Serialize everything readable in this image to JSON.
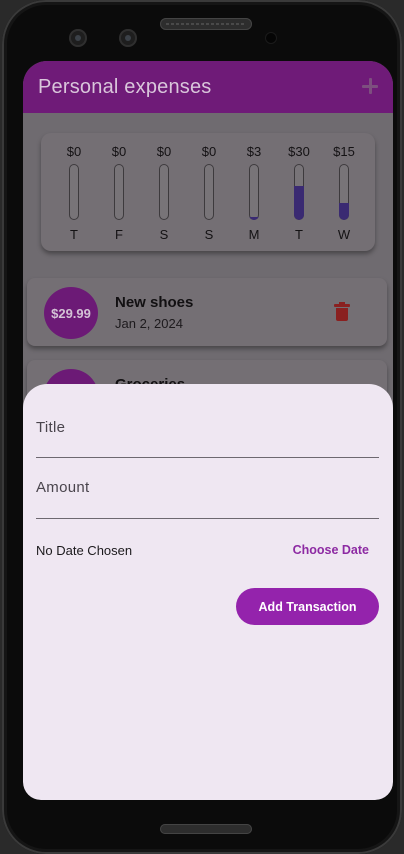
{
  "app_bar": {
    "title": "Personal expenses",
    "add_icon": "plus-icon"
  },
  "chart_data": {
    "type": "bar",
    "categories": [
      "T",
      "F",
      "S",
      "S",
      "M",
      "T",
      "W"
    ],
    "values": [
      0,
      0,
      0,
      0,
      3,
      30,
      15
    ],
    "labels": [
      "$0",
      "$0",
      "$0",
      "$0",
      "$3",
      "$30",
      "$15"
    ],
    "fill_fraction": [
      0,
      0,
      0,
      0,
      0.06,
      0.6,
      0.3
    ],
    "bar_color": "#3a2a72"
  },
  "transactions": [
    {
      "amount": "$29.99",
      "title": "New shoes",
      "date": "Jan 2, 2024",
      "delete_icon": "trash-icon"
    },
    {
      "amount": "",
      "title": "Groceries",
      "date": ""
    }
  ],
  "form": {
    "title_label": "Title",
    "amount_label": "Amount",
    "date_status": "No Date Chosen",
    "choose_date_label": "Choose Date",
    "submit_label": "Add Transaction",
    "accent_color": "#9423ac"
  }
}
